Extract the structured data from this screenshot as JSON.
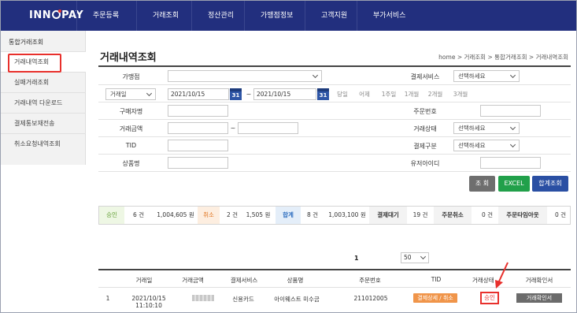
{
  "brand": {
    "logo_text_left": "INN",
    "logo_text_right": "PAY"
  },
  "nav": [
    "주문등록",
    "거래조회",
    "정산관리",
    "가맹점정보",
    "고객지원",
    "부가서비스"
  ],
  "sidebar": {
    "title": "통합거래조회",
    "items": [
      "거래내역조회",
      "실패거래조회",
      "거래내역 다운로드",
      "결제통보재전송",
      "취소요청내역조회"
    ]
  },
  "page": {
    "title": "거래내역조회",
    "breadcrumb": "home > 거래조회 > 통합거래조회 > 거래내역조회"
  },
  "form": {
    "merchant_label": "가맹점",
    "payment_service_label": "결제서비스",
    "payment_service_value": "선택하세요",
    "date_type_value": "거래일",
    "date_from": "2021/10/15",
    "date_to": "2021/10/15",
    "date_sep": "~",
    "cal_label": "31",
    "quick_ranges": [
      "당일",
      "어제",
      "1주일",
      "1개월",
      "2개월",
      "3개월"
    ],
    "buyer_label": "구매자명",
    "order_no_label": "주문번호",
    "amount_label": "거래금액",
    "amount_sep": "~",
    "status_label": "거래상태",
    "status_value": "선택하세요",
    "tid_label": "TID",
    "pay_type_label": "결제구분",
    "pay_type_value": "선택하세요",
    "product_label": "상품명",
    "user_id_label": "유저아이디"
  },
  "buttons": {
    "search": "조 회",
    "excel": "EXCEL",
    "total_search": "합계조회"
  },
  "summary": {
    "approve_label": "승인",
    "approve_count": "6 건",
    "approve_amount": "1,004,605 원",
    "cancel_label": "취소",
    "cancel_count": "2 건",
    "cancel_amount": "1,505 원",
    "total_label": "합계",
    "total_count": "8 건",
    "total_amount": "1,003,100 원",
    "pending_label": "결제대기",
    "pending_count": "19 건",
    "order_cancel_label": "주문취소",
    "order_cancel_count": "0 건",
    "timeout_label": "주문타임아웃",
    "timeout_count": "0 건"
  },
  "pagination": {
    "current": "1",
    "page_size": "50"
  },
  "table": {
    "headers": [
      "거래일",
      "거래금액",
      "결제서비스",
      "상품명",
      "주문번호",
      "TID",
      "거래상태",
      "거래확인서"
    ],
    "rows": [
      {
        "no": "1",
        "date": "2021/10/15 11:10:10",
        "service": "신용카드",
        "product": "아이웨스트 미수금",
        "order_no": "211012005",
        "tid_action": "결제상세 / 취소",
        "status": "승인",
        "receipt": "거래확인서"
      }
    ]
  }
}
